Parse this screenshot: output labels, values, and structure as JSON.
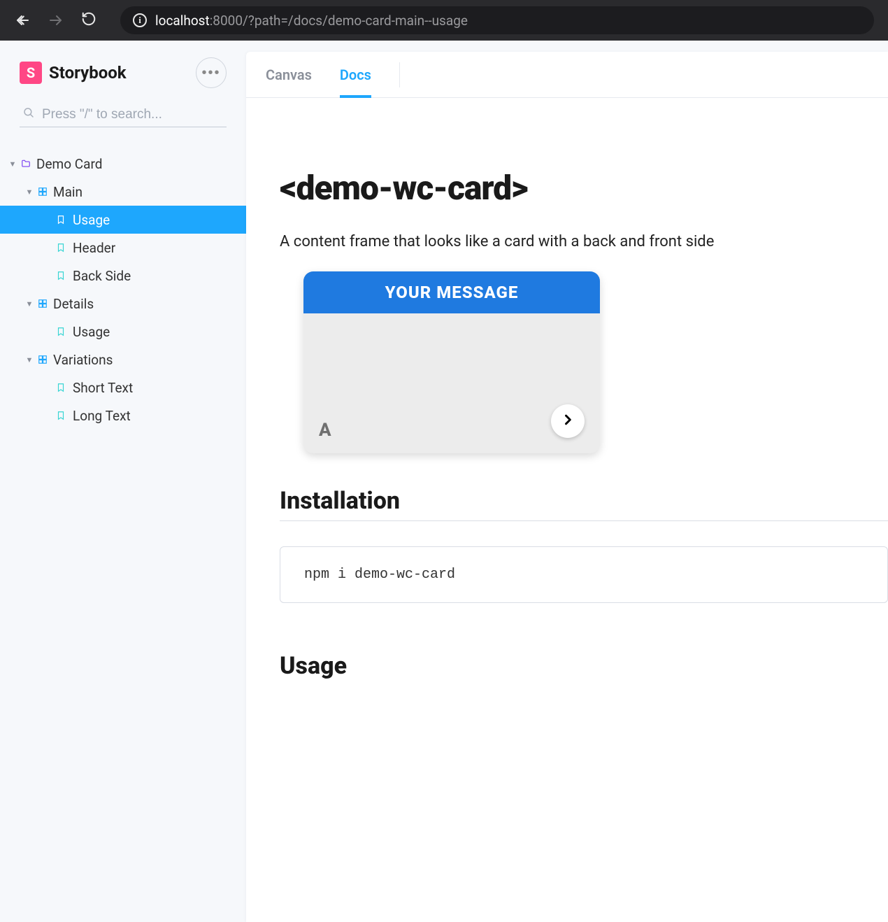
{
  "browser": {
    "url_host": "localhost",
    "url_rest": ":8000/?path=/docs/demo-card-main--usage"
  },
  "sidebar": {
    "brand": "Storybook",
    "search_placeholder": "Press \"/\" to search...",
    "tree": {
      "root_label": "Demo Card",
      "main": {
        "label": "Main",
        "stories": [
          "Usage",
          "Header",
          "Back Side"
        ]
      },
      "details": {
        "label": "Details",
        "stories": [
          "Usage"
        ]
      },
      "variations": {
        "label": "Variations",
        "stories": [
          "Short Text",
          "Long Text"
        ]
      }
    }
  },
  "tabs": {
    "canvas": "Canvas",
    "docs": "Docs"
  },
  "doc": {
    "title": "<demo-wc-card>",
    "description": "A content frame that looks like a card with a back and front side",
    "card_header": "YOUR MESSAGE",
    "card_letter": "A",
    "section_installation": "Installation",
    "install_code": "npm i demo-wc-card",
    "section_usage": "Usage"
  }
}
